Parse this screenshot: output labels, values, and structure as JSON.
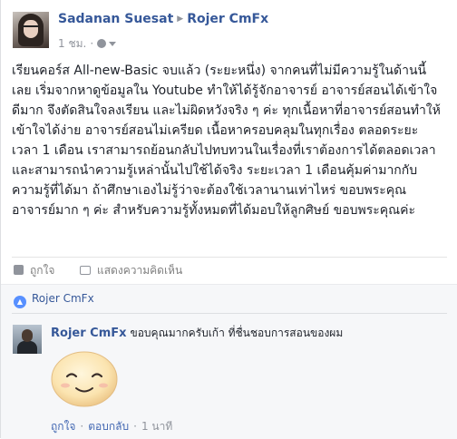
{
  "post": {
    "author": "Sadanan Suesat",
    "target": "Rojer CmFx",
    "time": "1 ชม.",
    "text": "เรียนคอร์ส All-new-Basic จบแล้ว (ระยะหนึ่ง) จากคนที่ไม่มีความรู้ในด้านนี้เลย เริ่มจากหาดูข้อมูลใน Youtube ทำให้ได้รู้จักอาจารย์ อาจารย์สอนได้เข้าใจดีมาก จึงตัดสินใจลงเรียน และไม่ผิดหวังจริง ๆ ค่ะ ทุกเนื้อหาที่อาจารย์สอนทำให้เข้าใจได้ง่าย อาจารย์สอนไม่เครียด เนื้อหาครอบคลุมในทุกเรื่อง ตลอดระยะเวลา 1 เดือน เราสามารถย้อนกลับไปทบทวนในเรื่องที่เราต้องการได้ตลอดเวลา และสามารถนำความรู้เหล่านั้นไปใช้ได้จริง ระยะเวลา 1 เดือนคุ้มค่ามากกับความรู้ที่ได้มา ถ้าศึกษาเองไม่รู้ว่าจะต้องใช้เวลานานเท่าไหร่ ขอบพระคุณอาจารย์มาก ๆ ค่ะ สำหรับความรู้ทั้งหมดที่ได้มอบให้ลูกศิษย์ ขอบพระคุณค่ะ"
  },
  "actions": {
    "like_label": "ถูกใจ",
    "comment_label": "แสดงความคิดเห็น"
  },
  "reactions": {
    "name": "Rojer CmFx"
  },
  "comment": {
    "author": "Rojer CmFx",
    "text": "ขอบคุณมากครับเก้า ที่ชื่นชอบการสอนของผม",
    "like_label": "ถูกใจ",
    "reply_label": "ตอบกลับ",
    "time": "1 นาที"
  },
  "colors": {
    "link": "#365899",
    "muted": "#90949c",
    "text": "#1d2129",
    "comment_bg": "#f6f7f9"
  }
}
